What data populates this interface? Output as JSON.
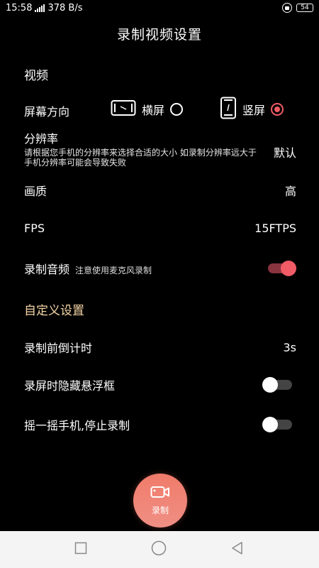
{
  "status": {
    "time": "15:58",
    "net_speed": "378 B/s",
    "battery": "54"
  },
  "header": {
    "title": "录制视频设置"
  },
  "video_section": {
    "heading": "视频",
    "orientation": {
      "label": "屏幕方向",
      "landscape_label": "横屏",
      "portrait_label": "竖屏",
      "selected": "portrait"
    },
    "resolution": {
      "label": "分辨率",
      "description": "请根据您手机的分辨率来选择合适的大小 如录制分辨率远大于手机分辨率可能会导致失败",
      "value": "默认"
    },
    "quality": {
      "label": "画质",
      "value": "高"
    },
    "fps": {
      "label": "FPS",
      "value": "15FTPS"
    },
    "audio": {
      "label": "录制音频",
      "note": "注意使用麦克风录制",
      "enabled": true
    }
  },
  "custom_section": {
    "heading": "自定义设置",
    "countdown": {
      "label": "录制前倒计时",
      "value": "3s"
    },
    "hide_float": {
      "label": "录屏时隐藏悬浮框",
      "enabled": false
    },
    "shake_stop": {
      "label": "摇一摇手机,停止录制",
      "enabled": false
    }
  },
  "record_button": {
    "label": "录制"
  },
  "colors": {
    "accent": "#f15b66",
    "custom_heading": "#f5d4a6",
    "record_button": "#f07b6a"
  }
}
